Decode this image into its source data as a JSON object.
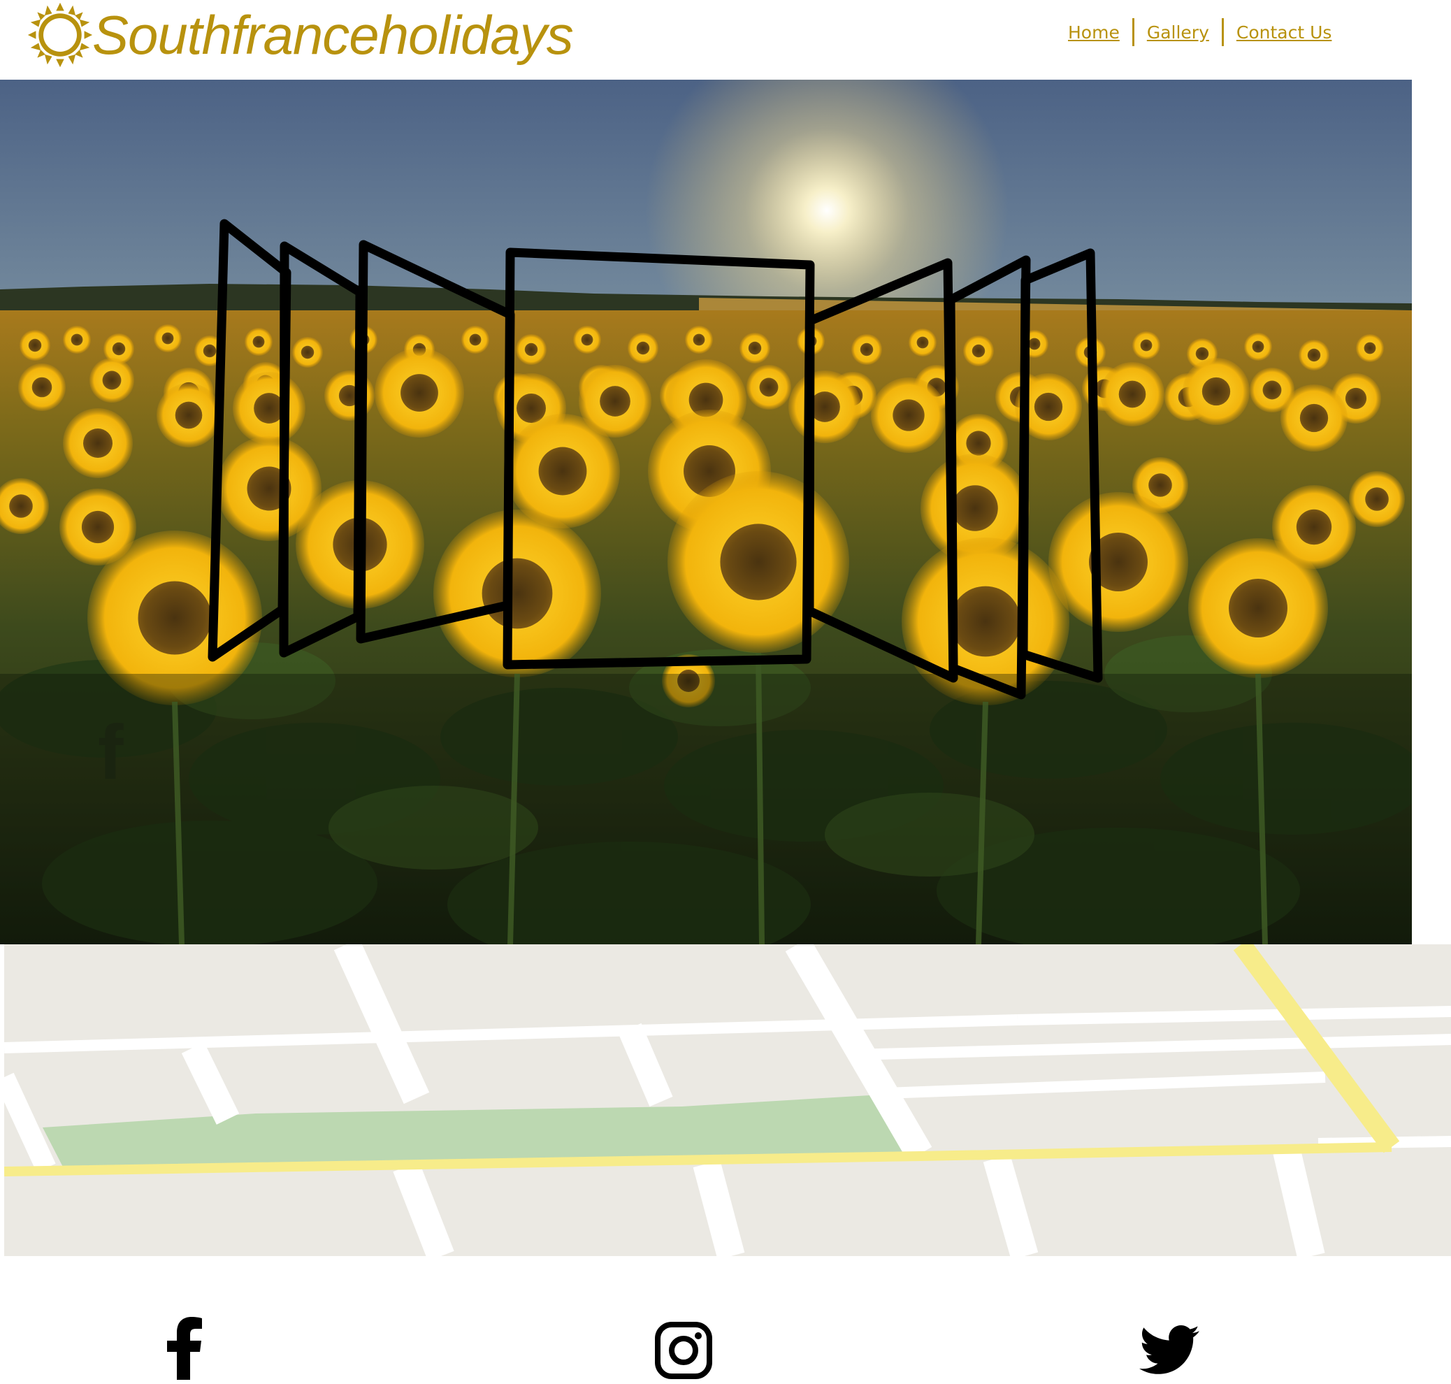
{
  "header": {
    "brand": "Southfranceholidays",
    "brand_color": "#b8920e",
    "logo_icon": "sun-icon"
  },
  "nav": {
    "items": [
      {
        "label": "Home"
      },
      {
        "label": "Gallery"
      },
      {
        "label": "Contact Us"
      }
    ]
  },
  "hero": {
    "image": "sunflower-field-sunset",
    "overlay_icon": "gallery-panels-icon",
    "overlay_glyph": "f"
  },
  "map": {
    "type": "street-map",
    "colors": {
      "ground": "#ebe9e3",
      "road": "#ffffff",
      "highway": "#f7ec8a",
      "park": "#bcd8b1"
    }
  },
  "social": {
    "icons": [
      "facebook-icon",
      "instagram-icon",
      "twitter-icon"
    ]
  }
}
